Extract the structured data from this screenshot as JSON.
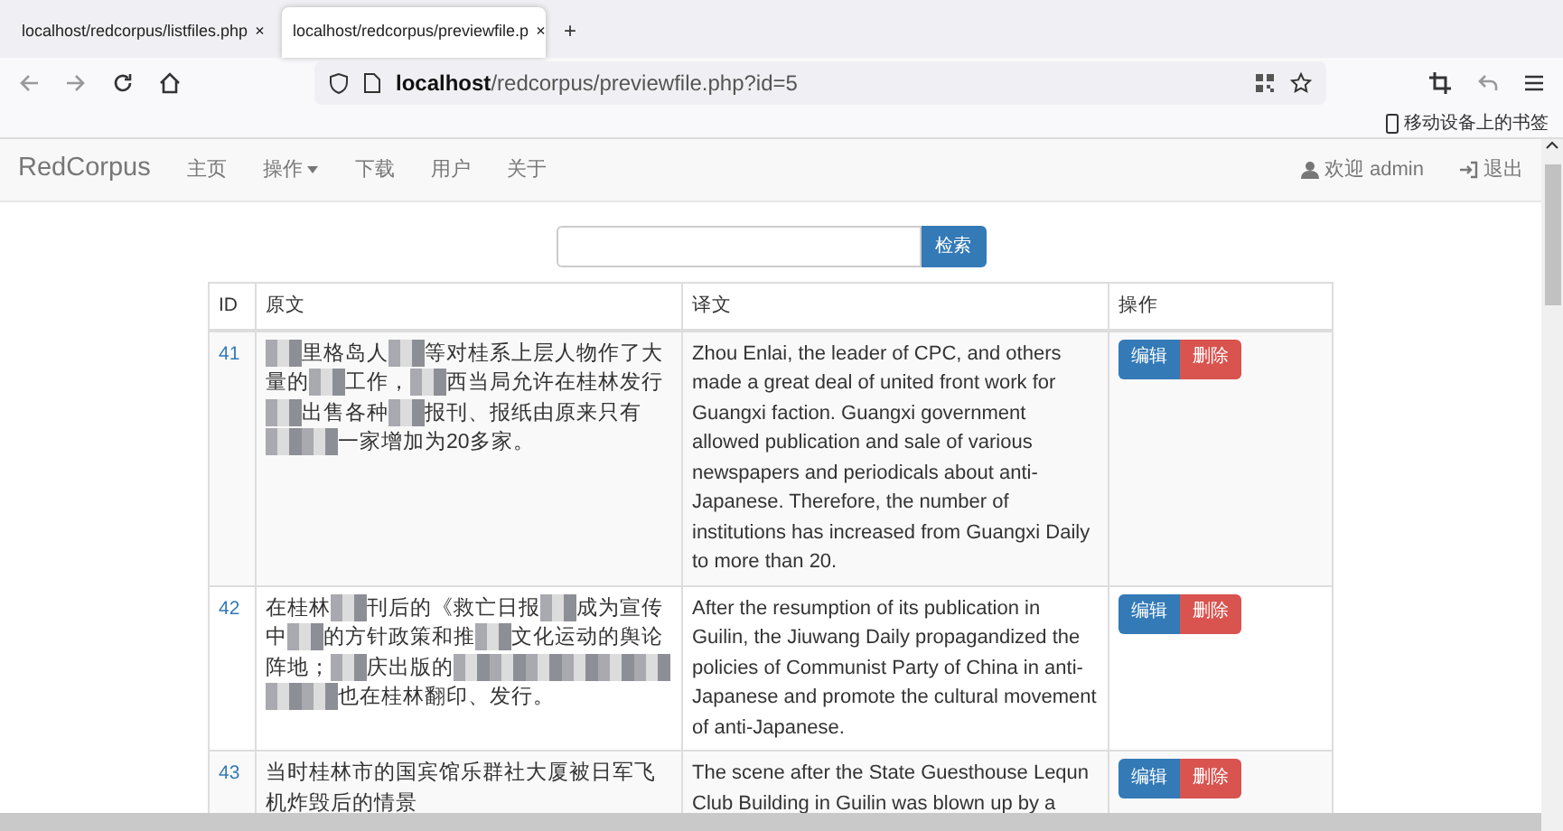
{
  "browser": {
    "tabs": [
      {
        "title": "localhost/redcorpus/listfiles.php",
        "close": "×",
        "selected": false
      },
      {
        "title": "localhost/redcorpus/previewfile.p",
        "close": "×",
        "selected": true
      }
    ],
    "new_tab": "+",
    "address": {
      "host": "localhost",
      "path": "/redcorpus/previewfile.php?id=5"
    },
    "bookmarks": "移动设备上的书签"
  },
  "navbar": {
    "brand": "RedCorpus",
    "items": [
      {
        "label": "主页",
        "dropdown": false
      },
      {
        "label": "操作",
        "dropdown": true
      },
      {
        "label": "下载",
        "dropdown": false
      },
      {
        "label": "用户",
        "dropdown": false
      },
      {
        "label": "关于",
        "dropdown": false
      }
    ],
    "user": "欢迎 admin",
    "logout": "退出"
  },
  "search": {
    "button": "检索"
  },
  "table": {
    "columns": [
      "ID",
      "原文",
      "译文",
      "操作"
    ],
    "rows": [
      {
        "id": "41",
        "original": [
          {
            "kind": "redacted"
          },
          {
            "kind": "text",
            "text": "里格岛人"
          },
          {
            "kind": "redacted"
          },
          {
            "kind": "text",
            "text": "等对桂系上层人物作了大量的"
          },
          {
            "kind": "redacted"
          },
          {
            "kind": "text",
            "text": "工作，"
          },
          {
            "kind": "redacted"
          },
          {
            "kind": "text",
            "text": "西当局允许在桂林发行"
          },
          {
            "kind": "redacted"
          },
          {
            "kind": "text",
            "text": "出售各种"
          },
          {
            "kind": "redacted"
          },
          {
            "kind": "text",
            "text": "报刊、报纸由原来只有"
          },
          {
            "kind": "redacted"
          },
          {
            "kind": "redacted"
          },
          {
            "kind": "text",
            "text": "一家增加为20多家。"
          }
        ],
        "translation": "Zhou Enlai, the leader of CPC, and others made a great deal of united front work for Guangxi faction. Guangxi government allowed publication and sale of various newspapers and periodicals about anti-Japanese. Therefore, the number of institutions has increased from Guangxi Daily to more than 20.",
        "edit": "编辑",
        "delete": "删除"
      },
      {
        "id": "42",
        "original": [
          {
            "kind": "text",
            "text": "在桂林"
          },
          {
            "kind": "redacted"
          },
          {
            "kind": "text",
            "text": "刊后的《救亡日报"
          },
          {
            "kind": "redacted"
          },
          {
            "kind": "text",
            "text": "成为宣传中"
          },
          {
            "kind": "redacted"
          },
          {
            "kind": "text",
            "text": "的方针政策和推"
          },
          {
            "kind": "redacted"
          },
          {
            "kind": "text",
            "text": "文化运动的舆论阵地；"
          },
          {
            "kind": "redacted"
          },
          {
            "kind": "text",
            "text": "庆出版的"
          },
          {
            "kind": "redacted"
          },
          {
            "kind": "redacted"
          },
          {
            "kind": "redacted"
          },
          {
            "kind": "redacted"
          },
          {
            "kind": "redacted"
          },
          {
            "kind": "redacted"
          },
          {
            "kind": "redacted"
          },
          {
            "kind": "redacted"
          },
          {
            "kind": "text",
            "text": "也在桂林翻印、发行。"
          }
        ],
        "translation": "After the resumption of its publication in Guilin, the Jiuwang Daily propagandized the policies of Communist Party of China in anti-Japanese and promote the cultural movement of anti-Japanese.",
        "edit": "编辑",
        "delete": "删除"
      },
      {
        "id": "43",
        "original": [
          {
            "kind": "text",
            "text": "当时桂林市的国宾馆乐群社大厦被日军飞机炸毁后的情景"
          }
        ],
        "translation": "The scene after the State Guesthouse Lequn Club Building in Guilin was blown up by a",
        "edit": "编辑",
        "delete": "删除"
      }
    ]
  }
}
